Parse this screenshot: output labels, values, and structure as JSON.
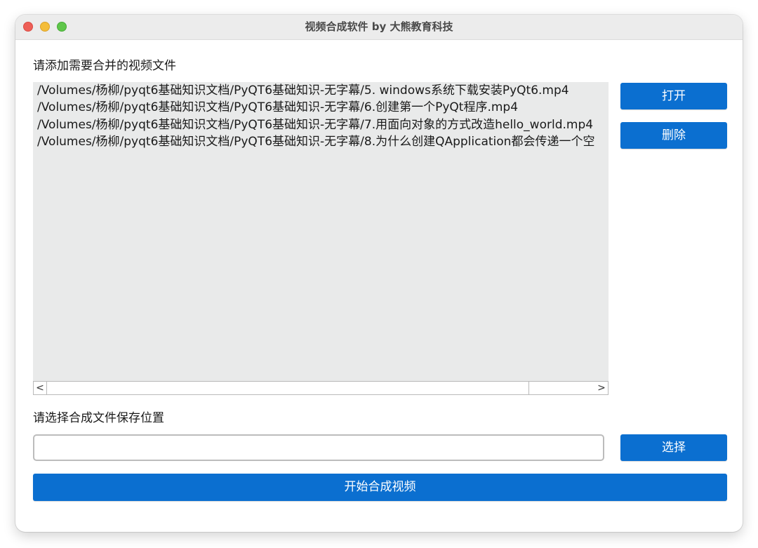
{
  "window": {
    "title": "视频合成软件 by 大熊教育科技"
  },
  "file_section": {
    "label": "请添加需要合并的视频文件",
    "files": [
      "/Volumes/杨柳/pyqt6基础知识文档/PyQT6基础知识-无字幕/5. windows系统下载安装PyQt6.mp4",
      "/Volumes/杨柳/pyqt6基础知识文档/PyQT6基础知识-无字幕/6.创建第一个PyQt程序.mp4",
      "/Volumes/杨柳/pyqt6基础知识文档/PyQT6基础知识-无字幕/7.用面向对象的方式改造hello_world.mp4",
      "/Volumes/杨柳/pyqt6基础知识文档/PyQT6基础知识-无字幕/8.为什么创建QApplication都会传递一个空"
    ],
    "open_button": "打开",
    "delete_button": "删除",
    "scroll_left": "<",
    "scroll_right": ">"
  },
  "save_section": {
    "label": "请选择合成文件保存位置",
    "path_value": "",
    "select_button": "选择"
  },
  "start_button": "开始合成视频",
  "colors": {
    "accent": "#0b6fd0",
    "list_background": "#e9eaea"
  }
}
